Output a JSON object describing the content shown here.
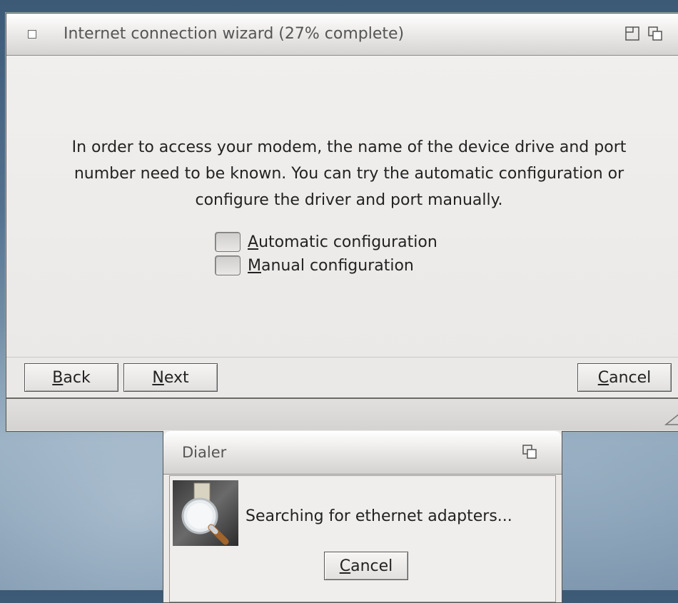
{
  "wizard": {
    "title": "Internet connection wizard (27% complete)",
    "message": "In order to access your modem, the name of the device drive and port number need to be known. You can try the automatic configuration or configure the driver and port manually.",
    "options": [
      {
        "mnemonic": "A",
        "rest": "utomatic configuration",
        "checked": false
      },
      {
        "mnemonic": "M",
        "rest": "anual configuration",
        "checked": false
      }
    ],
    "buttons": {
      "back": {
        "mnemonic": "B",
        "rest": "ack"
      },
      "next": {
        "mnemonic": "N",
        "rest": "ext"
      },
      "cancel": {
        "mnemonic": "C",
        "rest": "ancel"
      }
    }
  },
  "dialer": {
    "title": "Dialer",
    "status": "Searching for ethernet adapters...",
    "cancel": {
      "mnemonic": "C",
      "rest": "ancel"
    }
  },
  "icons": [
    "window-menu-icon",
    "maximize-icon",
    "depth-icon",
    "resize-grip-icon",
    "magnifier-icon"
  ]
}
